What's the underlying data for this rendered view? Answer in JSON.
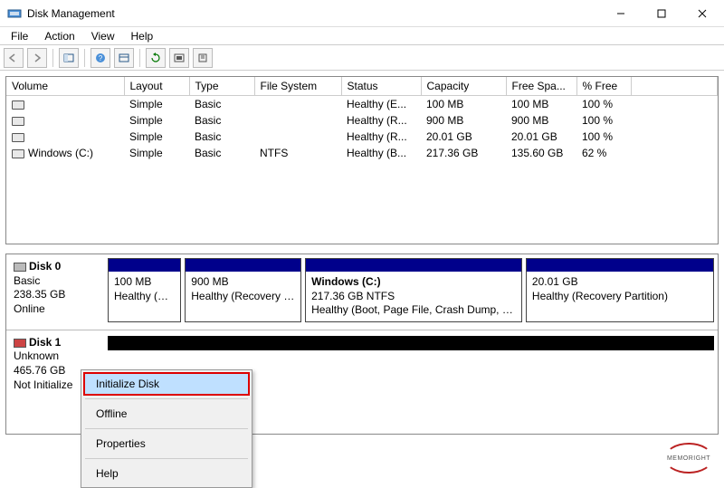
{
  "window": {
    "title": "Disk Management"
  },
  "menu": {
    "file": "File",
    "action": "Action",
    "view": "View",
    "help": "Help"
  },
  "columns": {
    "volume": "Volume",
    "layout": "Layout",
    "type": "Type",
    "filesystem": "File System",
    "status": "Status",
    "capacity": "Capacity",
    "freespace": "Free Spa...",
    "pctfree": "% Free"
  },
  "volumes": [
    {
      "name": "",
      "layout": "Simple",
      "type": "Basic",
      "fs": "",
      "status": "Healthy (E...",
      "capacity": "100 MB",
      "free": "100 MB",
      "pct": "100 %"
    },
    {
      "name": "",
      "layout": "Simple",
      "type": "Basic",
      "fs": "",
      "status": "Healthy (R...",
      "capacity": "900 MB",
      "free": "900 MB",
      "pct": "100 %"
    },
    {
      "name": "",
      "layout": "Simple",
      "type": "Basic",
      "fs": "",
      "status": "Healthy (R...",
      "capacity": "20.01 GB",
      "free": "20.01 GB",
      "pct": "100 %"
    },
    {
      "name": "Windows (C:)",
      "layout": "Simple",
      "type": "Basic",
      "fs": "NTFS",
      "status": "Healthy (B...",
      "capacity": "217.36 GB",
      "free": "135.60 GB",
      "pct": "62 %"
    }
  ],
  "disk0": {
    "name": "Disk 0",
    "type": "Basic",
    "size": "238.35 GB",
    "state": "Online",
    "parts": [
      {
        "title": "",
        "line1": "100 MB",
        "line2": "Healthy (EFI S",
        "flex": 1
      },
      {
        "title": "",
        "line1": "900 MB",
        "line2": "Healthy (Recovery Par",
        "flex": 1.6
      },
      {
        "title": "Windows  (C:)",
        "line1": "217.36 GB NTFS",
        "line2": "Healthy (Boot, Page File, Crash Dump, Prim",
        "flex": 3.0
      },
      {
        "title": "",
        "line1": "20.01 GB",
        "line2": "Healthy (Recovery Partition)",
        "flex": 2.6
      }
    ]
  },
  "disk1": {
    "name": "Disk 1",
    "type": "Unknown",
    "size": "465.76 GB",
    "state": "Not Initialize"
  },
  "context": {
    "init": "Initialize Disk",
    "offline": "Offline",
    "properties": "Properties",
    "help": "Help"
  },
  "watermark": "MEMORIGHT"
}
